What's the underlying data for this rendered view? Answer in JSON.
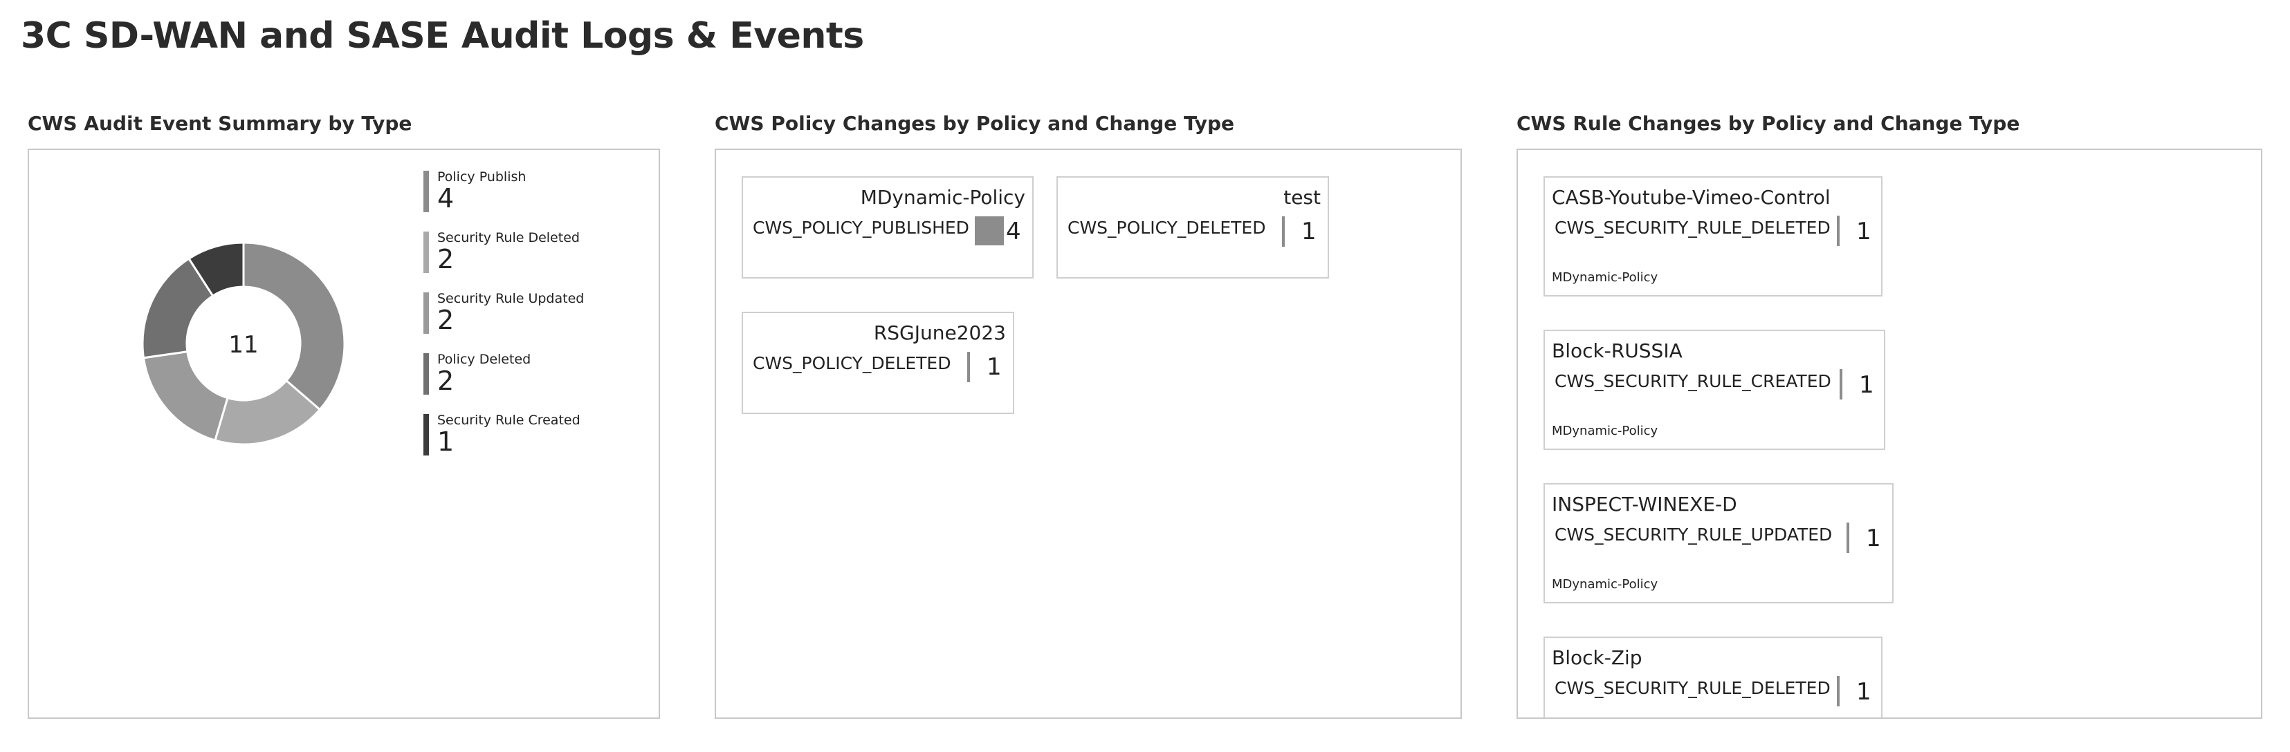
{
  "page": {
    "title": "3C SD-WAN and SASE Audit Logs & Events"
  },
  "panels": {
    "summary": {
      "title": "CWS Audit Event Summary by Type"
    },
    "policy": {
      "title": "CWS Policy Changes by Policy and Change Type"
    },
    "rule": {
      "title": "CWS Rule Changes by Policy and Change Type"
    }
  },
  "chart_data": {
    "type": "pie",
    "variant": "donut",
    "center_label": "11",
    "categories": [
      "Policy Publish",
      "Security Rule Deleted",
      "Security Rule Updated",
      "Policy Deleted",
      "Security Rule Created"
    ],
    "values": [
      4,
      2,
      2,
      2,
      1
    ],
    "colors": [
      "#8c8c8c",
      "#a9a9a9",
      "#9a9a9a",
      "#707070",
      "#3c3c3c"
    ],
    "legend_placement": "right"
  },
  "policy_cards": [
    {
      "name": "MDynamic-Policy",
      "type": "CWS_POLICY_PUBLISHED",
      "count": "4",
      "count_value": 4
    },
    {
      "name": "test",
      "type": "CWS_POLICY_DELETED",
      "count": "1",
      "count_value": 1
    },
    {
      "name": "RSGJune2023",
      "type": "CWS_POLICY_DELETED",
      "count": "1",
      "count_value": 1
    }
  ],
  "rule_cards": [
    {
      "name": "CASB-Youtube-Vimeo-Control",
      "type": "CWS_SECURITY_RULE_DELETED",
      "count": "1",
      "policy": "MDynamic-Policy"
    },
    {
      "name": "Block-RUSSIA",
      "type": "CWS_SECURITY_RULE_CREATED",
      "count": "1",
      "policy": "MDynamic-Policy"
    },
    {
      "name": "INSPECT-WINEXE-D",
      "type": "CWS_SECURITY_RULE_UPDATED",
      "count": "1",
      "policy": "MDynamic-Policy"
    },
    {
      "name": "Block-Zip",
      "type": "CWS_SECURITY_RULE_DELETED",
      "count": "1",
      "policy": ""
    }
  ]
}
